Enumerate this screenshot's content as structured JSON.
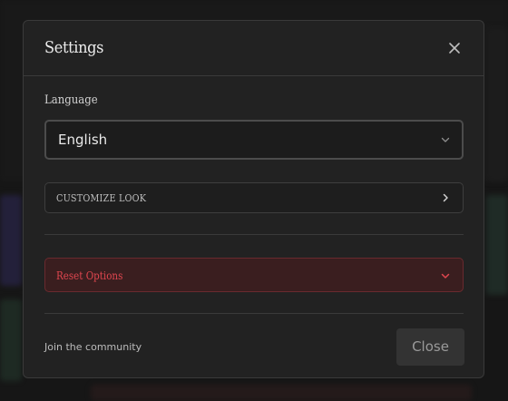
{
  "dialog": {
    "title": "Settings",
    "close_icon": "close-icon"
  },
  "language": {
    "label": "Language",
    "selected": "English",
    "chevron_icon": "chevron-down-icon"
  },
  "customize": {
    "label": "CUSTOMIZE LOOK",
    "arrow_icon": "chevron-right-icon"
  },
  "reset": {
    "label": "Reset Options",
    "chevron_icon": "chevron-down-icon",
    "color": "#e0464f"
  },
  "footer": {
    "community_text": "Join the community",
    "close_label": "Close"
  }
}
